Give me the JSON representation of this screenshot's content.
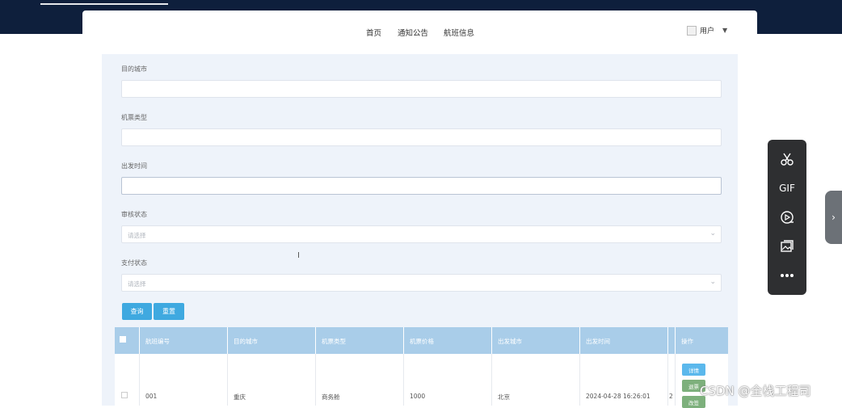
{
  "nav": {
    "items": [
      "首页",
      "通知公告",
      "航班信息"
    ],
    "user_label": "用户"
  },
  "search": {
    "fields": [
      {
        "label": "目的城市",
        "value": ""
      },
      {
        "label": "机票类型",
        "value": ""
      },
      {
        "label": "出发时间",
        "value": ""
      }
    ],
    "selects": [
      {
        "label": "审核状态",
        "placeholder": "请选择"
      },
      {
        "label": "支付状态",
        "placeholder": "请选择"
      }
    ],
    "query_button": "查询",
    "reset_button": "重置"
  },
  "table": {
    "headers": [
      "航班编号",
      "目的城市",
      "机票类型",
      "机票价格",
      "出发城市",
      "出发时间",
      "",
      "操作"
    ],
    "rows": [
      {
        "cells": [
          "001",
          "重庆",
          "商务舱",
          "1000",
          "北京",
          "2024-04-28 16:26:01",
          "2"
        ]
      }
    ],
    "actions": [
      {
        "label": "详情",
        "color": "#5bb8ec"
      },
      {
        "label": "退票",
        "color": "#7db07c"
      },
      {
        "label": "改签",
        "color": "#7db07c"
      }
    ]
  },
  "toolbar": {
    "icons": [
      "scissors-icon",
      "gif-icon",
      "screen-record-icon",
      "image-icon",
      "more-icon"
    ],
    "gif_label": "GIF"
  },
  "watermark": "CSDN @全栈工程司",
  "colors": {
    "topbar": "#0e1f3c",
    "panel": "#eef3fa",
    "button": "#3fa9e0",
    "table_header": "#a9cde9"
  }
}
